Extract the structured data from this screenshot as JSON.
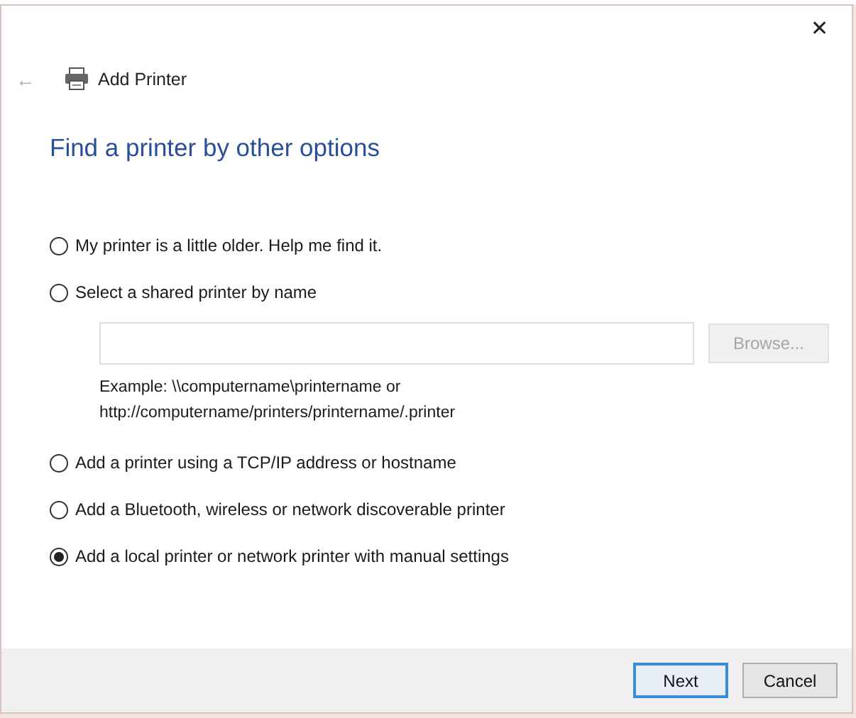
{
  "window": {
    "close": "✕"
  },
  "header": {
    "back": "←",
    "title": "Add Printer"
  },
  "heading": "Find a printer by other options",
  "options": [
    {
      "label": "My printer is a little older. Help me find it.",
      "selected": false
    },
    {
      "label": "Select a shared printer by name",
      "selected": false,
      "browse": {
        "label": "Browse...",
        "disabled": true
      },
      "example": [
        "Example: \\\\computername\\printername or",
        "http://computername/printers/printername/.printer"
      ]
    },
    {
      "label": "Add a printer using a TCP/IP address or hostname",
      "selected": false
    },
    {
      "label": "Add a Bluetooth, wireless or network discoverable printer",
      "selected": false
    },
    {
      "label": "Add a local printer or network printer with manual settings",
      "selected": true
    }
  ],
  "buttons": [
    {
      "label": "Next",
      "kind": "default"
    },
    {
      "label": "Cancel",
      "kind": "normal"
    }
  ]
}
